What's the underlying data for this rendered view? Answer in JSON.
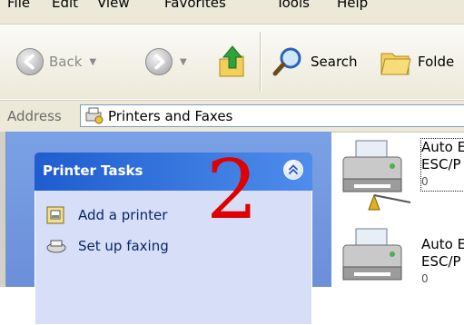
{
  "menubar": {
    "items": [
      "File",
      "Edit",
      "View",
      "Favorites",
      "Tools",
      "Help"
    ]
  },
  "toolbar": {
    "back_label": "Back",
    "search_label": "Search",
    "folders_label": "Folde"
  },
  "address": {
    "label": "Address",
    "value": "Printers and Faxes"
  },
  "task_panel": {
    "title": "Printer Tasks",
    "items": [
      {
        "label": "Add a printer",
        "icon": "add-printer-icon"
      },
      {
        "label": "Set up faxing",
        "icon": "fax-icon"
      }
    ]
  },
  "annotation": "2",
  "printers": [
    {
      "line1": "Auto E",
      "line2": "ESC/P",
      "status": "0"
    },
    {
      "line1": "Auto E",
      "line2": "ESC/P",
      "status": "0"
    }
  ],
  "colors": {
    "task_header": "#1f5cce",
    "left_pane": "#7aa1e6",
    "annotation": "#e00000",
    "link": "#0a246a"
  }
}
